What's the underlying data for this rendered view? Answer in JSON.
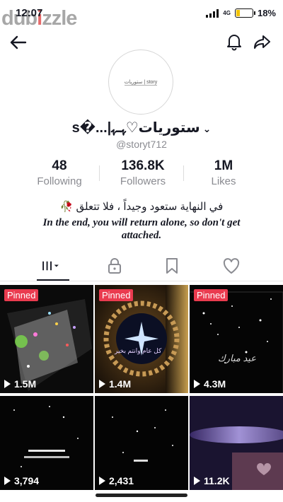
{
  "status": {
    "time": "12:07",
    "network": "4G",
    "battery": "18%",
    "battery_level": 0.18
  },
  "watermark": {
    "text_a": "dub",
    "text_dot": "i",
    "text_b": "zzle"
  },
  "profile": {
    "avatar_text": "ستوريات | story",
    "name": "s�...|ستوريات♡ﮩـﮩ",
    "handle": "@storyt712",
    "stats": [
      {
        "value": "48",
        "label": "Following"
      },
      {
        "value": "136.8K",
        "label": "Followers"
      },
      {
        "value": "1M",
        "label": "Likes"
      }
    ],
    "bio_ar": "في النهاية ستعود وجيداً ، فلا تتعلق 🥀",
    "bio_en": "In the end, you will return alone, so don't get attached."
  },
  "tabs": [
    "videos-grid",
    "private",
    "saved",
    "liked"
  ],
  "videos": [
    {
      "pinned": "Pinned",
      "views": "1.5M"
    },
    {
      "pinned": "Pinned",
      "views": "1.4M",
      "caption": "كل عام وانتم بخير"
    },
    {
      "pinned": "Pinned",
      "views": "4.3M",
      "caption": "عيد مبارك"
    },
    {
      "pinned": "",
      "views": "3,794"
    },
    {
      "pinned": "",
      "views": "2,431"
    },
    {
      "pinned": "",
      "views": "11.2K"
    }
  ],
  "colors": {
    "pinned": "#ea3b4f",
    "text": "#161823",
    "muted": "#8a8b91"
  }
}
